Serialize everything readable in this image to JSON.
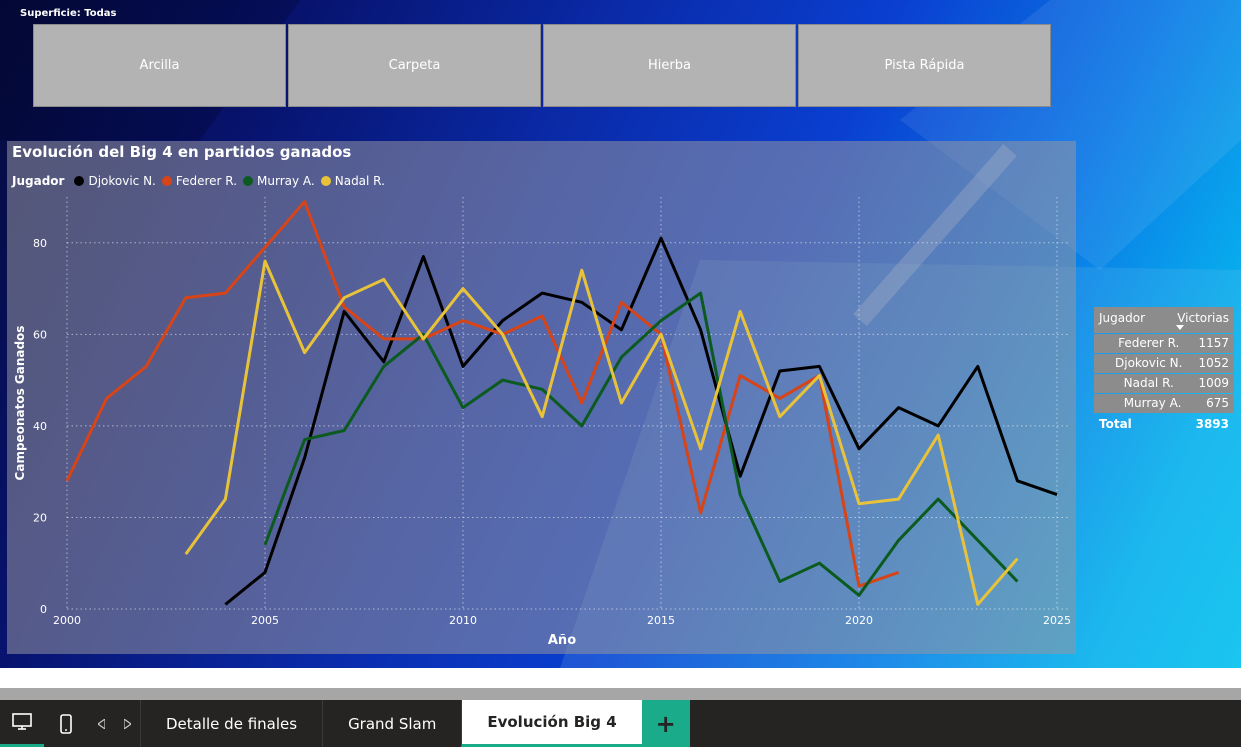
{
  "slicer": {
    "title": "Superficie: Todas",
    "options": [
      "Arcilla",
      "Carpeta",
      "Hierba",
      "Pista Rápida"
    ]
  },
  "chart": {
    "title": "Evolución del Big 4 en partidos ganados",
    "legend_title": "Jugador",
    "ylabel": "Campeonatos Ganados",
    "xlabel": "Año"
  },
  "chart_data": {
    "type": "line",
    "title": "Evolución del Big 4 en partidos ganados",
    "xlabel": "Año",
    "ylabel": "Campeonatos Ganados",
    "xlim": [
      2000,
      2025
    ],
    "ylim": [
      0,
      90
    ],
    "xticks": [
      2000,
      2005,
      2010,
      2015,
      2020,
      2025
    ],
    "yticks": [
      0,
      20,
      40,
      60,
      80
    ],
    "grid": true,
    "legend_position": "top-left",
    "series": [
      {
        "name": "Djokovic N.",
        "color": "#000000",
        "x": [
          2004,
          2005,
          2006,
          2007,
          2008,
          2009,
          2010,
          2011,
          2012,
          2013,
          2014,
          2015,
          2016,
          2017,
          2018,
          2019,
          2020,
          2021,
          2022,
          2023,
          2024,
          2025
        ],
        "y": [
          1,
          8,
          33,
          65,
          54,
          77,
          53,
          63,
          69,
          67,
          61,
          81,
          61,
          29,
          52,
          53,
          35,
          44,
          40,
          53,
          28,
          25
        ]
      },
      {
        "name": "Federer R.",
        "color": "#d64417",
        "x": [
          2000,
          2001,
          2002,
          2003,
          2004,
          2005,
          2006,
          2007,
          2008,
          2009,
          2010,
          2011,
          2012,
          2013,
          2014,
          2015,
          2016,
          2017,
          2018,
          2019,
          2020,
          2021
        ],
        "y": [
          28,
          46,
          53,
          68,
          69,
          79,
          89,
          66,
          59,
          59,
          63,
          60,
          64,
          45,
          67,
          60,
          21,
          51,
          46,
          51,
          5,
          8
        ]
      },
      {
        "name": "Murray A.",
        "color": "#0b5a1f",
        "x": [
          2005,
          2006,
          2007,
          2008,
          2009,
          2010,
          2011,
          2012,
          2013,
          2014,
          2015,
          2016,
          2017,
          2018,
          2019,
          2020,
          2021,
          2022,
          2023,
          2024
        ],
        "y": [
          14,
          37,
          39,
          53,
          60,
          44,
          50,
          48,
          40,
          55,
          63,
          69,
          25,
          6,
          10,
          3,
          15,
          24,
          15,
          6
        ]
      },
      {
        "name": "Nadal R.",
        "color": "#e8c33a",
        "x": [
          2003,
          2004,
          2005,
          2006,
          2007,
          2008,
          2009,
          2010,
          2011,
          2012,
          2013,
          2014,
          2015,
          2016,
          2017,
          2018,
          2019,
          2020,
          2021,
          2022,
          2023,
          2024
        ],
        "y": [
          12,
          24,
          76,
          56,
          68,
          72,
          59,
          70,
          60,
          42,
          74,
          45,
          60,
          35,
          65,
          42,
          51,
          23,
          24,
          38,
          1,
          11
        ]
      }
    ]
  },
  "table": {
    "col_player": "Jugador",
    "col_wins": "Victorias",
    "rows": [
      {
        "player": "Federer R.",
        "wins": "1157"
      },
      {
        "player": "Djokovic N.",
        "wins": "1052"
      },
      {
        "player": "Nadal R.",
        "wins": "1009"
      },
      {
        "player": "Murray A.",
        "wins": "675"
      }
    ],
    "total_label": "Total",
    "total_value": "3893"
  },
  "tabs": {
    "pages": [
      "Detalle de finales",
      "Grand Slam",
      "Evolución Big 4"
    ],
    "active_index": 2,
    "add_label": "+"
  }
}
